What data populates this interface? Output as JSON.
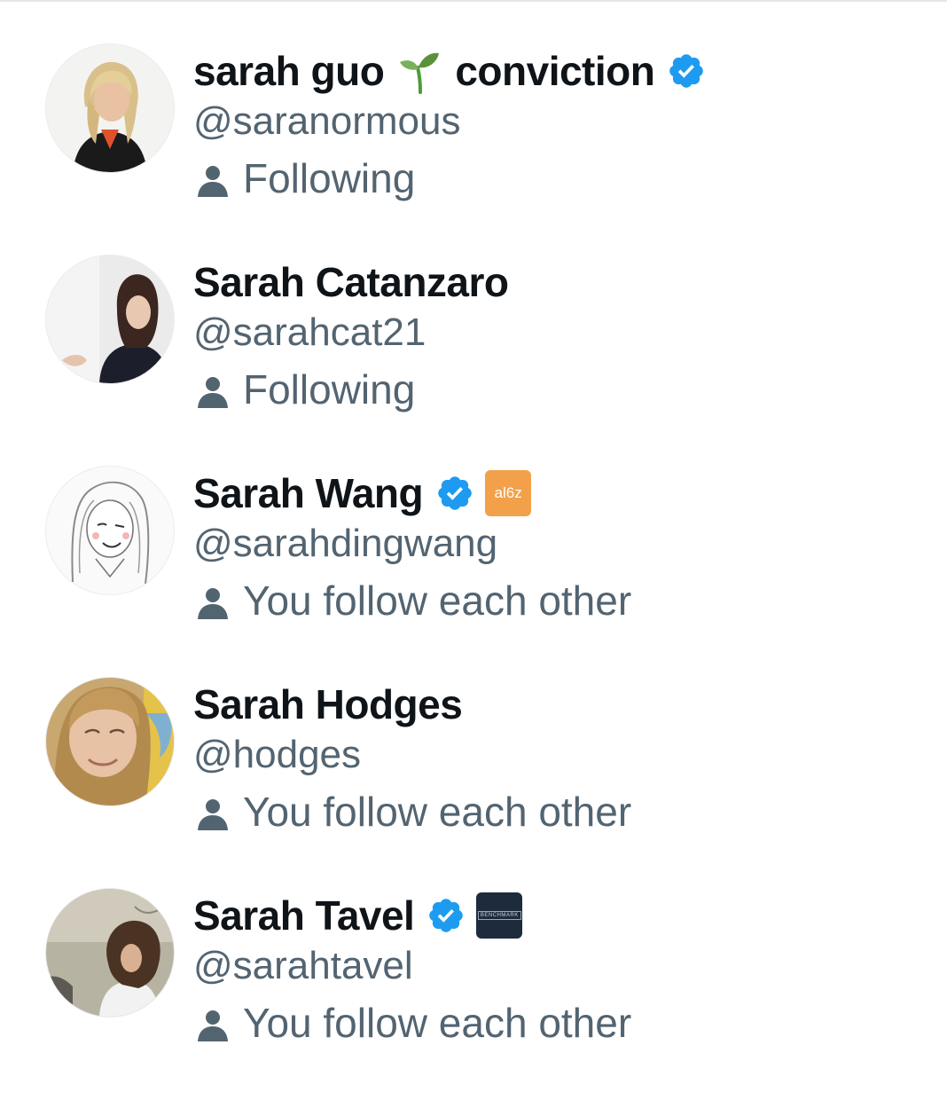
{
  "colors": {
    "text_primary": "#0f1419",
    "text_secondary": "#536471",
    "verified_blue": "#1d9bf0"
  },
  "users": [
    {
      "name": "sarah guo",
      "name_suffix": "conviction",
      "emoji_icon": "sprout-icon",
      "verified": true,
      "affiliation": null,
      "handle": "@saranormous",
      "status_icon": "person-icon",
      "status": "Following"
    },
    {
      "name": "Sarah Catanzaro",
      "verified": false,
      "affiliation": null,
      "handle": "@sarahcat21",
      "status_icon": "person-icon",
      "status": "Following"
    },
    {
      "name": "Sarah Wang",
      "verified": true,
      "affiliation": "a16z",
      "affiliation_text": "al6z",
      "handle": "@sarahdingwang",
      "status_icon": "person-icon",
      "status": "You follow each other"
    },
    {
      "name": "Sarah Hodges",
      "verified": false,
      "affiliation": null,
      "handle": "@hodges",
      "status_icon": "person-icon",
      "status": "You follow each other"
    },
    {
      "name": "Sarah Tavel",
      "verified": true,
      "affiliation": "benchmark",
      "affiliation_text": "BENCHMARK",
      "handle": "@sarahtavel",
      "status_icon": "person-icon",
      "status": "You follow each other"
    }
  ]
}
